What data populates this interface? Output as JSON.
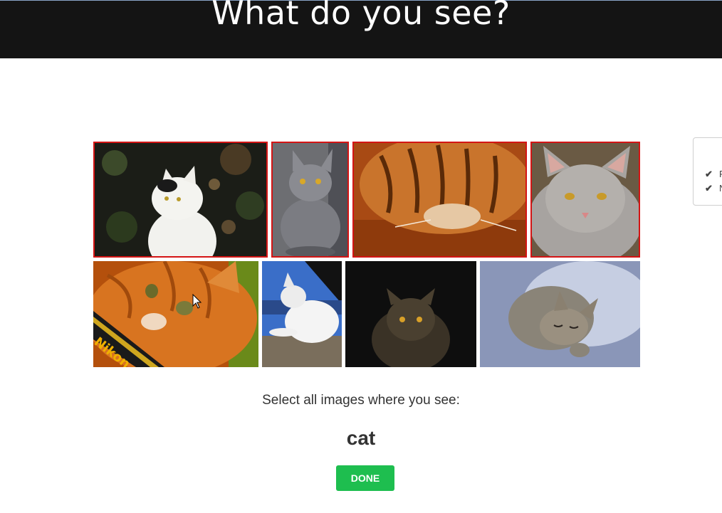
{
  "header": {
    "title": "What do you see?"
  },
  "grid": {
    "tiles": [
      {
        "subject": "white-and-black cat in dark garden",
        "selected": true
      },
      {
        "subject": "grey cat lying down",
        "selected": true
      },
      {
        "subject": "orange tabby cat close-up",
        "selected": true
      },
      {
        "subject": "grey long-haired cat portrait",
        "selected": true
      },
      {
        "subject": "orange cat with camera strap",
        "selected": false,
        "strap_text": "Nikon"
      },
      {
        "subject": "white kitten on wooden bench",
        "selected": false
      },
      {
        "subject": "tabby cat in darkness",
        "selected": false
      },
      {
        "subject": "sleeping tabby kitten",
        "selected": false
      }
    ]
  },
  "side_panel": {
    "items": [
      {
        "icon": "check-icon",
        "label": "F"
      },
      {
        "icon": "check-icon",
        "label": "N"
      }
    ]
  },
  "instructions": {
    "prompt": "Select all images where you see:",
    "keyword": "cat"
  },
  "actions": {
    "done_label": "DONE"
  },
  "colors": {
    "header_bg": "#141414",
    "selected_border": "#d41414",
    "done_button": "#1ebe4f"
  }
}
